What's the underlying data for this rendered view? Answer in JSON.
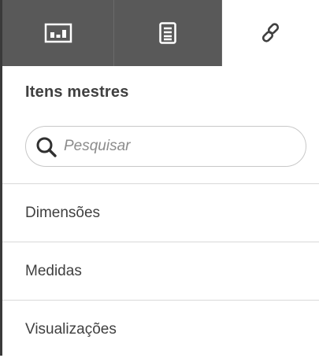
{
  "tabs": [
    {
      "icon": "charts-icon",
      "active": false
    },
    {
      "icon": "fields-list-icon",
      "active": false
    },
    {
      "icon": "master-items-link-icon",
      "active": true
    }
  ],
  "section": {
    "title": "Itens mestres"
  },
  "search": {
    "placeholder": "Pesquisar",
    "value": "",
    "icon": "search-icon"
  },
  "items": [
    {
      "label": "Dimensões"
    },
    {
      "label": "Medidas"
    },
    {
      "label": "Visualizações"
    }
  ],
  "colors": {
    "tab_inactive_bg": "#595959",
    "tab_active_bg": "#ffffff",
    "text": "#404040",
    "divider": "#d9d9d9"
  }
}
